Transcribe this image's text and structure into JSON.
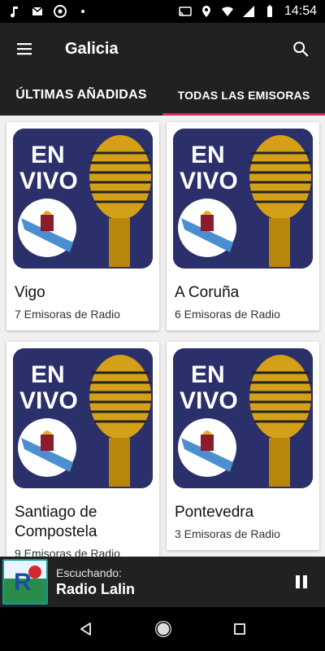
{
  "status_bar": {
    "time": "14:54",
    "left_icons": [
      "music-note-icon",
      "mail-icon",
      "camera-aperture-icon",
      "dot-icon"
    ],
    "right_icons": [
      "cast-icon",
      "location-icon",
      "wifi-icon",
      "signal-icon",
      "battery-icon"
    ]
  },
  "app_bar": {
    "title": "Galicia",
    "menu_icon": "hamburger-menu-icon",
    "search_icon": "search-icon"
  },
  "tabs": [
    {
      "label": "ÚLTIMAS AÑADIDAS",
      "active": false
    },
    {
      "label": "TODAS LAS EMISORAS",
      "active": true
    }
  ],
  "cards": [
    {
      "image_text_line1": "EN",
      "image_text_line2": "VIVO",
      "name": "Vigo",
      "subtitle": "7 Emisoras de Radio"
    },
    {
      "image_text_line1": "EN",
      "image_text_line2": "VIVO",
      "name": "A Coruña",
      "subtitle": "6 Emisoras de Radio"
    },
    {
      "image_text_line1": "EN",
      "image_text_line2": "VIVO",
      "name": "Santiago de Compostela",
      "subtitle": "9 Emisoras de Radio"
    },
    {
      "image_text_line1": "EN",
      "image_text_line2": "VIVO",
      "name": "Pontevedra",
      "subtitle": "3 Emisoras de Radio"
    }
  ],
  "player": {
    "label": "Escuchando:",
    "station": "Radio Lalin",
    "pause_icon": "pause-icon"
  },
  "nav_bar": {
    "icons": [
      "back-icon",
      "home-icon",
      "recents-icon"
    ]
  },
  "colors": {
    "app_bar_bg": "#212121",
    "tab_indicator": "#e0245e",
    "card_image_bg": "#2b2f6a",
    "microphone_gold": "#d4a017"
  }
}
